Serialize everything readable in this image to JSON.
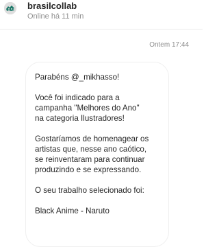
{
  "header": {
    "contact_name": "brasilcollab",
    "status": "Online há 11 min",
    "avatar_icon": "brasilcollab-logo-icon",
    "avatar_colors": {
      "background": "#dedede",
      "logo": "#1e7a6a"
    }
  },
  "conversation": {
    "timestamp": "Ontem 17:44",
    "message": {
      "paragraphs": [
        [
          "Parabéns @_mikhasso!"
        ],
        [
          "Você foi indicado para a",
          "campanha \"Melhores do Ano\"",
          "na categoria Ilustradores!"
        ],
        [
          "Gostaríamos de homenagear os",
          "artistas que, nesse ano caótico,",
          "se reinventaram para continuar",
          "produzindo e se expressando."
        ],
        [
          "O seu trabalho selecionado foi:"
        ],
        [
          "Black Anime - Naruto"
        ]
      ]
    }
  }
}
